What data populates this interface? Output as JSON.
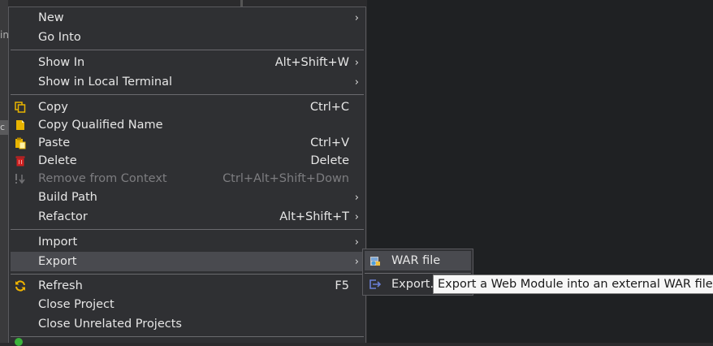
{
  "background": {
    "left_text": "in",
    "left_chip": "c"
  },
  "menu": {
    "items": [
      {
        "label": "New",
        "accel": "",
        "arrow": "›"
      },
      {
        "label": "Go Into",
        "accel": "",
        "arrow": ""
      },
      {
        "label": "Show In",
        "accel": "Alt+Shift+W",
        "arrow": "›"
      },
      {
        "label": "Show in Local Terminal",
        "accel": "",
        "arrow": "›"
      },
      {
        "label": "Copy",
        "accel": "Ctrl+C",
        "arrow": "",
        "icon": "copy-icon"
      },
      {
        "label": "Copy Qualified Name",
        "accel": "",
        "arrow": "",
        "icon": "copy-qualified-name-icon"
      },
      {
        "label": "Paste",
        "accel": "Ctrl+V",
        "arrow": "",
        "icon": "paste-icon"
      },
      {
        "label": "Delete",
        "accel": "Delete",
        "arrow": "",
        "icon": "delete-icon"
      },
      {
        "label": "Remove from Context",
        "accel": "Ctrl+Alt+Shift+Down",
        "arrow": "",
        "icon": "remove-context-icon",
        "disabled": true
      },
      {
        "label": "Build Path",
        "accel": "",
        "arrow": "›"
      },
      {
        "label": "Refactor",
        "accel": "Alt+Shift+T",
        "arrow": "›"
      },
      {
        "label": "Import",
        "accel": "",
        "arrow": "›"
      },
      {
        "label": "Export",
        "accel": "",
        "arrow": "›",
        "highlighted": true
      },
      {
        "label": "Refresh",
        "accel": "F5",
        "arrow": "",
        "icon": "refresh-icon"
      },
      {
        "label": "Close Project",
        "accel": "",
        "arrow": ""
      },
      {
        "label": "Close Unrelated Projects",
        "accel": "",
        "arrow": ""
      }
    ]
  },
  "submenu": {
    "items": [
      {
        "label": "WAR file",
        "icon": "war-file-icon",
        "highlighted": true
      },
      {
        "label": "Export...",
        "icon": "export-icon"
      }
    ]
  },
  "tooltip": {
    "text": "Export a Web Module into an external WAR file"
  },
  "colors": {
    "menu_bg": "#2f3033",
    "highlight": "#494a4f",
    "separator": "#6a6a6e",
    "copy_icon": "#e8b400",
    "delete_icon": "#d02020",
    "refresh_icon": "#f0b400",
    "export_icon": "#6a7fd6"
  }
}
